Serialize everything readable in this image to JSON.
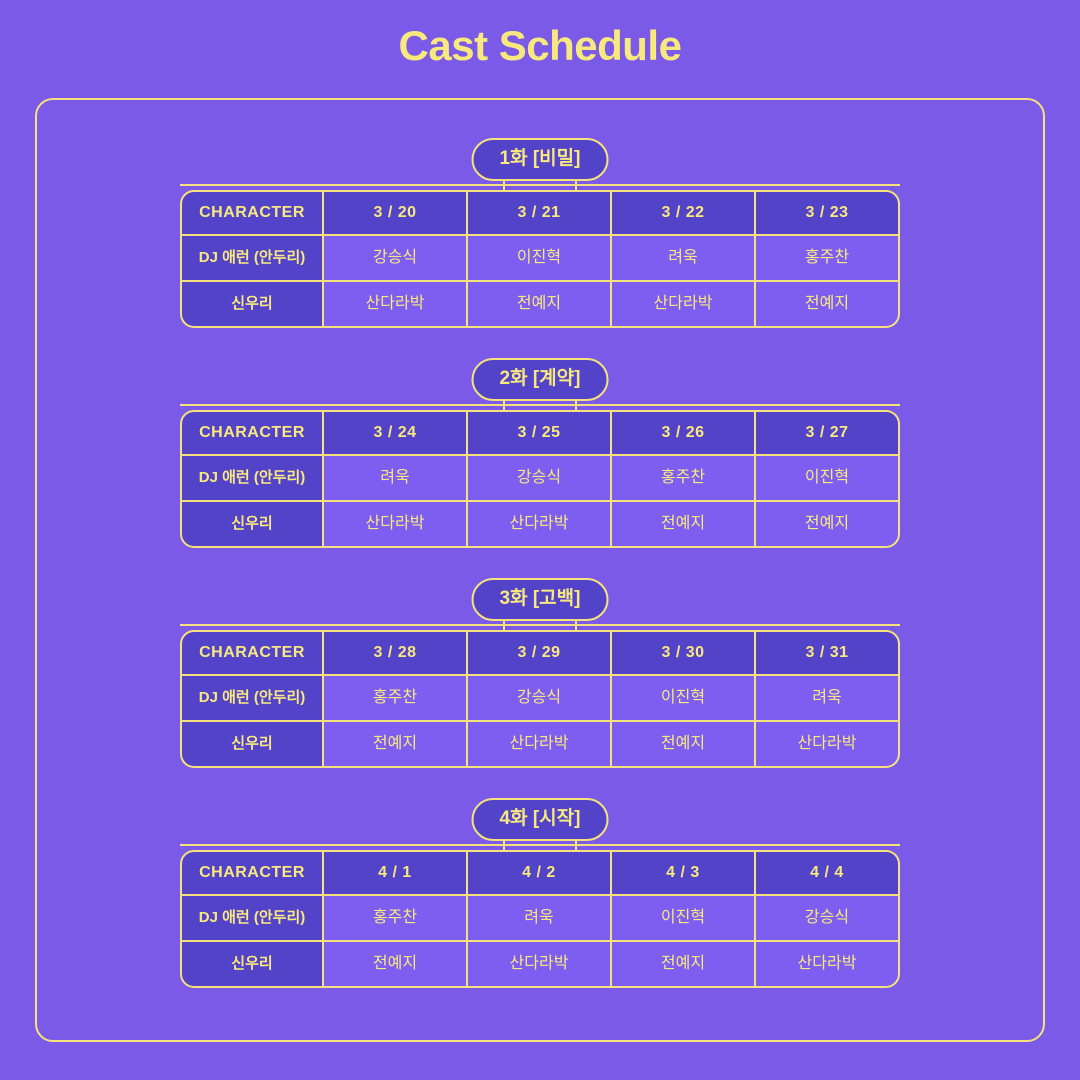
{
  "page": {
    "title": "Cast Schedule",
    "background_color": "#7a5ae6",
    "accent_color": "#f5e27e",
    "header_cell_color": "#5243c8",
    "data_cell_color": "#7d5ef0"
  },
  "table_labels": {
    "character_header": "CHARACTER",
    "role_rows": [
      "DJ 애런 (안두리)",
      "신우리"
    ]
  },
  "episodes": [
    {
      "badge": "1화 [비밀]",
      "dates": [
        "3 / 20",
        "3 / 21",
        "3 / 22",
        "3 / 23"
      ],
      "rows": [
        {
          "character": "DJ 애런 (안두리)",
          "cast": [
            "강승식",
            "이진혁",
            "려욱",
            "홍주찬"
          ]
        },
        {
          "character": "신우리",
          "cast": [
            "산다라박",
            "전예지",
            "산다라박",
            "전예지"
          ]
        }
      ]
    },
    {
      "badge": "2화 [계약]",
      "dates": [
        "3 / 24",
        "3 / 25",
        "3 / 26",
        "3 / 27"
      ],
      "rows": [
        {
          "character": "DJ 애런 (안두리)",
          "cast": [
            "려욱",
            "강승식",
            "홍주찬",
            "이진혁"
          ]
        },
        {
          "character": "신우리",
          "cast": [
            "산다라박",
            "산다라박",
            "전예지",
            "전예지"
          ]
        }
      ]
    },
    {
      "badge": "3화 [고백]",
      "dates": [
        "3 / 28",
        "3 / 29",
        "3 / 30",
        "3 / 31"
      ],
      "rows": [
        {
          "character": "DJ 애런 (안두리)",
          "cast": [
            "홍주찬",
            "강승식",
            "이진혁",
            "려욱"
          ]
        },
        {
          "character": "신우리",
          "cast": [
            "전예지",
            "산다라박",
            "전예지",
            "산다라박"
          ]
        }
      ]
    },
    {
      "badge": "4화 [시작]",
      "dates": [
        "4 / 1",
        "4 / 2",
        "4 / 3",
        "4 / 4"
      ],
      "rows": [
        {
          "character": "DJ 애런 (안두리)",
          "cast": [
            "홍주찬",
            "려욱",
            "이진혁",
            "강승식"
          ]
        },
        {
          "character": "신우리",
          "cast": [
            "전예지",
            "산다라박",
            "전예지",
            "산다라박"
          ]
        }
      ]
    }
  ]
}
